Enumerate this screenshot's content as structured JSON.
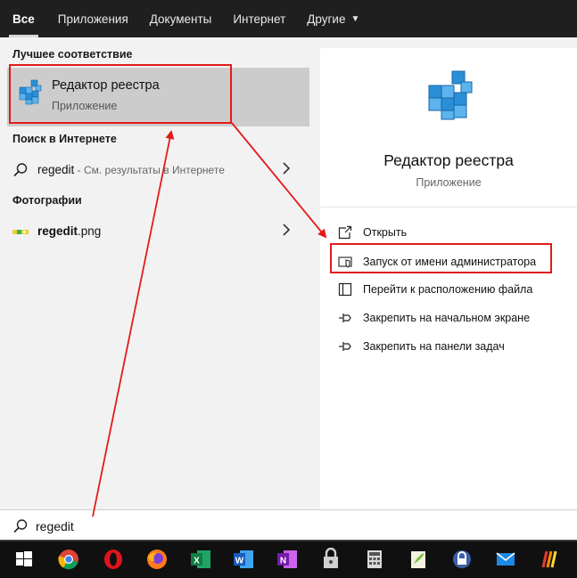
{
  "tabs": [
    {
      "label": "Все",
      "active": true
    },
    {
      "label": "Приложения"
    },
    {
      "label": "Документы"
    },
    {
      "label": "Интернет"
    },
    {
      "label": "Другие"
    }
  ],
  "left": {
    "best_header": "Лучшее соответствие",
    "best": {
      "title": "Редактор реестра",
      "subtitle": "Приложение",
      "icon": "registry-editor-icon"
    },
    "web_header": "Поиск в Интернете",
    "web_result": {
      "query": "regedit",
      "hint": " - См. результаты в Интернете"
    },
    "photos_header": "Фотографии",
    "photo_result": {
      "name_bold": "regedit",
      "name_rest": ".png"
    }
  },
  "preview": {
    "title": "Редактор реестра",
    "subtitle": "Приложение",
    "actions": [
      {
        "label": "Открыть",
        "icon": "open-icon"
      },
      {
        "label": "Запуск от имени администратора",
        "icon": "shield-icon"
      },
      {
        "label": "Перейти к расположению файла",
        "icon": "file-location-icon"
      },
      {
        "label": "Закрепить на начальном экране",
        "icon": "pin-icon"
      },
      {
        "label": "Закрепить на панели задач",
        "icon": "pin-icon"
      }
    ]
  },
  "search": {
    "value": "regedit"
  },
  "taskbar": [
    "windows-start",
    "chrome",
    "opera",
    "firefox",
    "excel",
    "word",
    "onenote",
    "vpn-lock",
    "calculator",
    "notepad-plus",
    "keepass",
    "mail",
    "app-stripes"
  ],
  "colors": {
    "highlight_box": "#e21b1b",
    "arrow": "#e21b1b",
    "selected_row": "#cccccc",
    "panel_bg": "#f2f2f2",
    "tabs_bg": "#1f1f1f",
    "taskbar_bg": "#101010"
  }
}
